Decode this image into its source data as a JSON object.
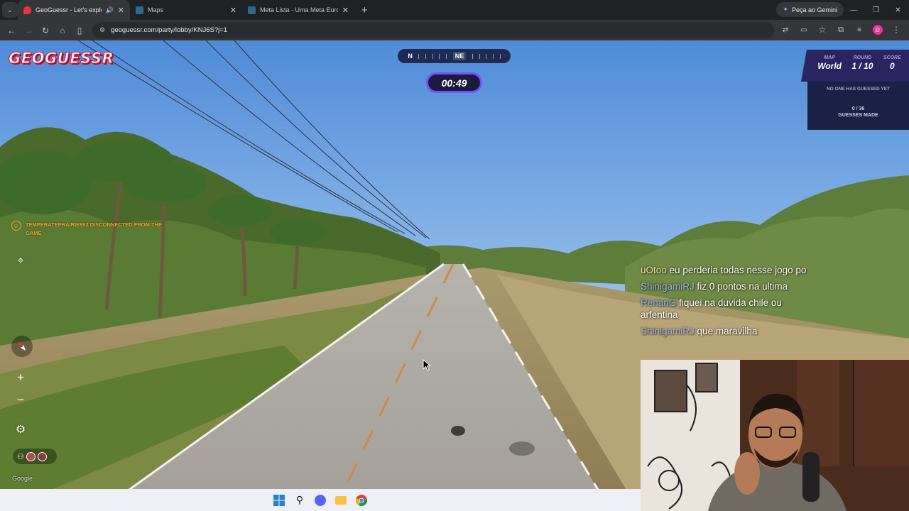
{
  "browser": {
    "tabs": [
      {
        "title": "GeoGuessr - Let's explore the world!",
        "active": true,
        "favicon_color": "#e8333c"
      },
      {
        "title": "Maps",
        "active": false,
        "favicon_color": "#2b6a8a"
      },
      {
        "title": "Meta Lista - Uma Meta Europa",
        "active": false,
        "favicon_color": "#2b6a8a"
      }
    ],
    "gemini_label": "Peça ao Gemini",
    "url": "geoguessr.com/party/lobby/KNJ6S?j=1",
    "profile_initial": "D"
  },
  "game": {
    "logo": "GEOGUESSR",
    "compass": {
      "left": "N",
      "current": "NE"
    },
    "timer": "00:49",
    "status": {
      "map_label": "MAP",
      "map_value": "World",
      "round_label": "ROUND",
      "round_value": "1 / 10",
      "score_label": "SCORE",
      "score_value": "0",
      "no_guess": "NO ONE HAS GUESSED YET",
      "guesses_count": "0 / 36",
      "guesses_label": "GUESSES MADE"
    },
    "notification": "TEMPERATEPRAIRIE892 DISCONNECTED FROM THE GAME",
    "attribution": "Google"
  },
  "chat": [
    {
      "user": "uOtoo",
      "user_color": "#f0e6a8",
      "text": "eu perderia todas nesse jogo po"
    },
    {
      "user": "ShinigamiRJ",
      "user_color": "#9fb6e6",
      "text": "fiz 0 pontos na ultima"
    },
    {
      "user": "RenanG",
      "user_color": "#7fb8f0",
      "text": "fiquei na duvida chile ou arfentina"
    },
    {
      "user": "ShinigamiRJ",
      "user_color": "#9fb6e6",
      "text": "que maravilha"
    }
  ],
  "colors": {
    "accent": "#7c4dff",
    "hud_dark": "#1a1b3f",
    "warning": "#f5a623"
  }
}
